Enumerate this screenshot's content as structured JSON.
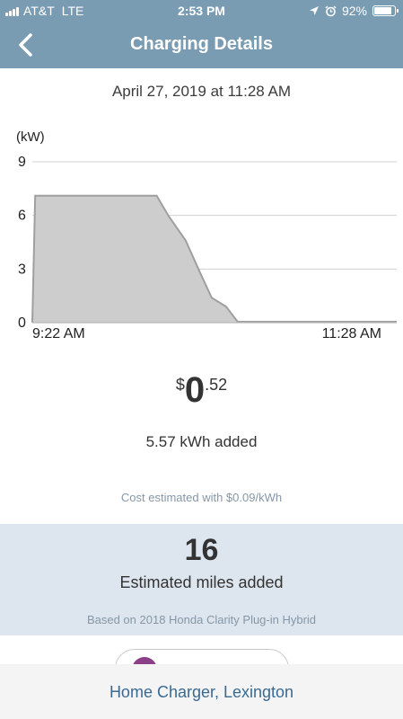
{
  "status_bar": {
    "carrier": "AT&T",
    "network": "LTE",
    "time": "2:53 PM",
    "battery": "92%",
    "icons": [
      "signal-icon",
      "location-arrow-icon",
      "alarm-icon",
      "battery-icon"
    ]
  },
  "header": {
    "title": "Charging Details",
    "back_icon": "chevron-left-icon"
  },
  "session": {
    "date": "April 27, 2019 at 11:28 AM"
  },
  "chart_data": {
    "type": "area",
    "ylabel": "(kW)",
    "ylim": [
      0,
      9
    ],
    "yticks": [
      "9",
      "6",
      "3",
      "0"
    ],
    "xtick_labels": [
      "9:22 AM",
      "11:28 AM"
    ],
    "x_minutes_after_start": [
      0,
      1,
      43,
      47,
      53,
      58,
      62,
      67,
      71,
      126
    ],
    "y": [
      0,
      7.1,
      7.1,
      6.0,
      4.6,
      2.8,
      1.4,
      0.9,
      0.05,
      0.05
    ],
    "grid": true,
    "colors": {
      "fill": "#cdcdcd",
      "line": "#9f9f9f",
      "grid": "#d0d0d0"
    }
  },
  "cost": {
    "symbol": "$",
    "dollars": "0",
    "cents": ".52"
  },
  "energy": {
    "added": "5.57 kWh added",
    "rate_note": "Cost estimated with $0.09/kWh"
  },
  "miles": {
    "value": "16",
    "label": "Estimated miles added",
    "vehicle_note": "Based on 2018 Honda Clarity Plug-in Hybrid"
  },
  "footer": {
    "location": "Home Charger, Lexington"
  },
  "colors": {
    "header_bg": "#7a9cb3",
    "panel_bg": "#dde6ee",
    "link": "#3a6a92",
    "muted": "#8597a7"
  }
}
